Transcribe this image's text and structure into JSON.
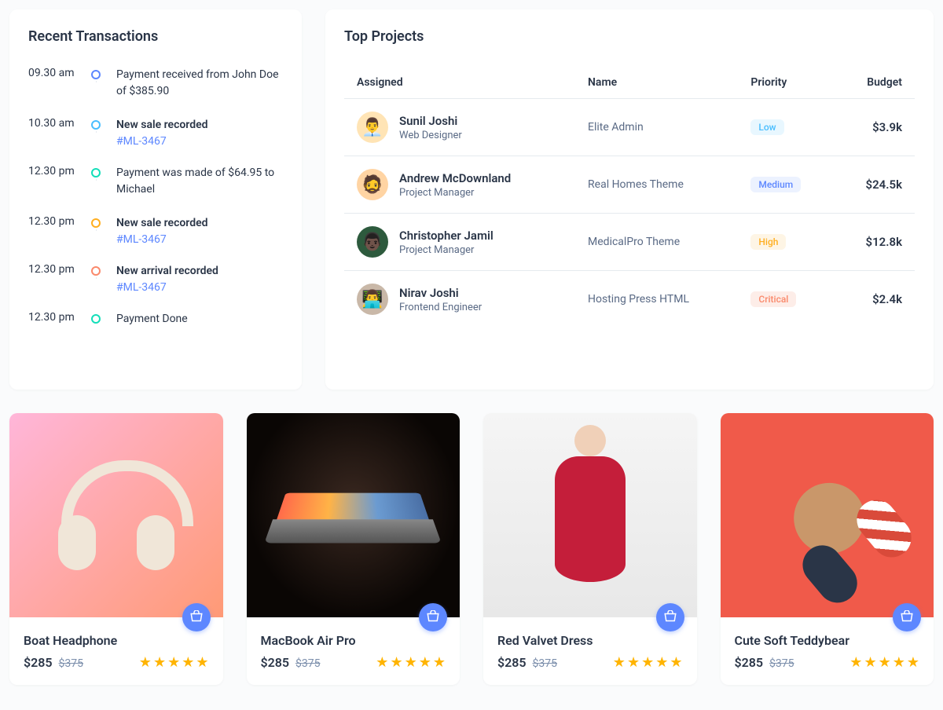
{
  "transactions": {
    "title": "Recent Transactions",
    "items": [
      {
        "time": "09.30 am",
        "dot": "primary",
        "text": "Payment received from John Doe of $385.90",
        "bold": false,
        "link": ""
      },
      {
        "time": "10.30 am",
        "dot": "secondary",
        "text": "New sale recorded",
        "bold": true,
        "link": "#ML-3467"
      },
      {
        "time": "12.30 pm",
        "dot": "success",
        "text": "Payment was made of $64.95 to Michael",
        "bold": false,
        "link": ""
      },
      {
        "time": "12.30 pm",
        "dot": "warning",
        "text": "New sale recorded",
        "bold": true,
        "link": "#ML-3467"
      },
      {
        "time": "12.30 pm",
        "dot": "error",
        "text": "New arrival recorded",
        "bold": true,
        "link": "#ML-3467"
      },
      {
        "time": "12.30 pm",
        "dot": "success",
        "text": "Payment Done",
        "bold": false,
        "link": ""
      }
    ]
  },
  "projects": {
    "title": "Top Projects",
    "headers": {
      "assigned": "Assigned",
      "name": "Name",
      "priority": "Priority",
      "budget": "Budget"
    },
    "rows": [
      {
        "person": "Sunil Joshi",
        "role": "Web Designer",
        "avatar_bg": "#ffe4b5",
        "emoji": "👨‍💼",
        "name": "Elite Admin",
        "priority": "Low",
        "chip": "low",
        "budget": "$3.9k"
      },
      {
        "person": "Andrew McDownland",
        "role": "Project Manager",
        "avatar_bg": "#ffd4a3",
        "emoji": "🧔",
        "name": "Real Homes Theme",
        "priority": "Medium",
        "chip": "medium",
        "budget": "$24.5k"
      },
      {
        "person": "Christopher Jamil",
        "role": "Project Manager",
        "avatar_bg": "#2d5a3d",
        "emoji": "👨🏿",
        "name": "MedicalPro Theme",
        "priority": "High",
        "chip": "high",
        "budget": "$12.8k"
      },
      {
        "person": "Nirav Joshi",
        "role": "Frontend Engineer",
        "avatar_bg": "#c9b8a8",
        "emoji": "👨‍💻",
        "name": "Hosting Press HTML",
        "priority": "Critical",
        "chip": "critical",
        "budget": "$2.4k"
      }
    ]
  },
  "products": [
    {
      "name": "Boat Headphone",
      "price": "$285",
      "old_price": "$375",
      "rating": 5,
      "img": "headphone"
    },
    {
      "name": "MacBook Air Pro",
      "price": "$285",
      "old_price": "$375",
      "rating": 5,
      "img": "macbook"
    },
    {
      "name": "Red Valvet Dress",
      "price": "$285",
      "old_price": "$375",
      "rating": 5,
      "img": "dress"
    },
    {
      "name": "Cute Soft Teddybear",
      "price": "$285",
      "old_price": "$375",
      "rating": 5,
      "img": "teddy"
    }
  ]
}
